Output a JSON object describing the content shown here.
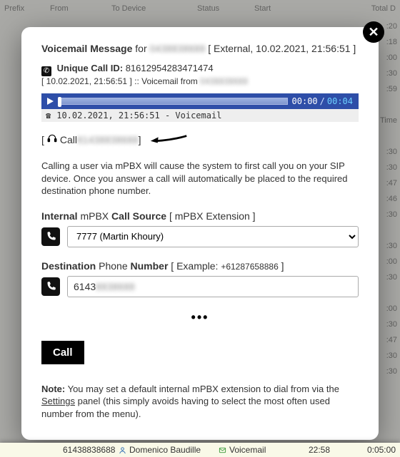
{
  "bgHeaders": {
    "prefix": "Prefix",
    "from": "From",
    "to": "To Device",
    "status": "Status",
    "start": "Start",
    "total": "Total D"
  },
  "rightTimes": [
    ":20",
    ":18",
    ":00",
    ":30",
    ":59",
    "",
    "Time",
    "",
    ":30",
    ":30",
    ":47",
    ":46",
    ":30",
    "",
    ":30",
    ":00",
    ":30",
    "",
    ":00",
    ":30",
    ":47",
    ":30",
    ":30"
  ],
  "modal": {
    "title_a": "Voicemail Message",
    "title_b": " for ",
    "title_num": "0438838688",
    "title_c": " [ External, 10.02.2021, 21:56:51 ]",
    "uid_label": "Unique Call ID:",
    "uid_val": "81612954283471474",
    "sub_a": "[ 10.02.2021, 21:56:51 ] :: Voicemail from ",
    "sub_num": "0438838688",
    "player": {
      "cur": "00:00",
      "sep": "/",
      "tot": "00:04"
    },
    "dl": "10.02.2021, 21:56:51 - Voicemail",
    "call_a": "[ ",
    "call_label": "Call ",
    "call_num": "61438838688",
    "call_b": " ]",
    "para": "Calling a user via mPBX will cause the system to first call you on your SIP device. Once you answer a call will automatically be placed to the required destination phone number.",
    "src_a": "Internal",
    "src_b": " mPBX ",
    "src_c": "Call Source",
    "src_d": " [ mPBX Extension ]",
    "src_option": "7777 (Martin Khoury)",
    "dest_a": "Destination",
    "dest_b": " Phone ",
    "dest_c": "Number",
    "dest_d": " [ Example: ",
    "dest_e": "+61287658886",
    "dest_f": " ]",
    "dest_prefix": "6143",
    "dest_blur": "8838688",
    "dots": "•••",
    "call_btn": "Call",
    "note_a": "Note:",
    "note_b": " You may set a default internal mPBX extension to dial from via the ",
    "note_link": "Settings",
    "note_c": " panel (this simply avoids having to select the most often used number from the menu)."
  },
  "bottom": {
    "num": "61438838688",
    "name": "Domenico Baudille",
    "vm": "Voicemail",
    "time": "22:58",
    "dur": "0:05:00"
  }
}
